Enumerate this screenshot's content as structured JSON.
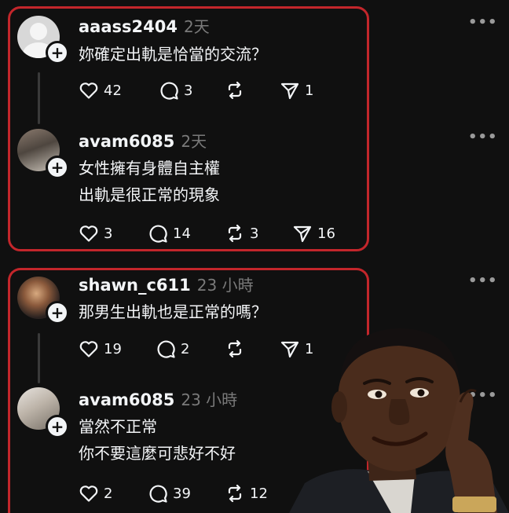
{
  "posts": [
    {
      "username": "aaass2404",
      "time": "2天",
      "lines": [
        "妳確定出軌是恰當的交流？"
      ],
      "likes": "42",
      "comments": "3",
      "reposts": "",
      "shares": "1"
    },
    {
      "username": "avam6085",
      "time": "2天",
      "lines": [
        "女性擁有身體自主權",
        "出軌是很正常的現象"
      ],
      "likes": "3",
      "comments": "14",
      "reposts": "3",
      "shares": "16"
    },
    {
      "username": "shawn_c611",
      "time": "23 小時",
      "lines": [
        "那男生出軌也是正常的嗎？"
      ],
      "likes": "19",
      "comments": "2",
      "reposts": "",
      "shares": "1"
    },
    {
      "username": "avam6085",
      "time": "23 小時",
      "lines": [
        "當然不正常",
        "你不要這麼可悲好不好"
      ],
      "likes": "2",
      "comments": "39",
      "reposts": "12",
      "shares": ""
    }
  ],
  "icons": {
    "more": "more-icon",
    "like": "heart-icon",
    "comment": "comment-icon",
    "repost": "repost-icon",
    "share": "share-icon",
    "follow": "plus-icon"
  },
  "colors": {
    "background": "#101010",
    "highlight_frame": "#c3262b",
    "text": "#f3f5f7",
    "muted": "#7a7a7a"
  },
  "more_glyph": "•••",
  "plus_glyph": "+"
}
